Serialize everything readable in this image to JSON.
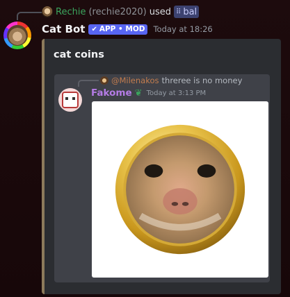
{
  "reply_ref": {
    "user": "Rechie",
    "handle": "(rechie2020)",
    "action": "used",
    "command": "bal",
    "command_icon": "slash-command-icon"
  },
  "message": {
    "author": "Cat Bot",
    "tag": "APP • MOD",
    "timestamp": "Today at 18:26"
  },
  "embed": {
    "title": "cat coins",
    "accent_color": "#8c7a5b",
    "inner": {
      "reply_mention": "@Milenakos",
      "reply_text": "threree is no money",
      "author": "Fakome",
      "badge_icon": "sprout-icon",
      "timestamp": "Today at 3:13 PM",
      "image": "gold-coin-cat-face"
    }
  },
  "colors": {
    "bot_tag": "#5865f2",
    "rechie_name": "#3ba55d",
    "fakome_name": "#b57ce6",
    "mention": "#c27c4e"
  }
}
